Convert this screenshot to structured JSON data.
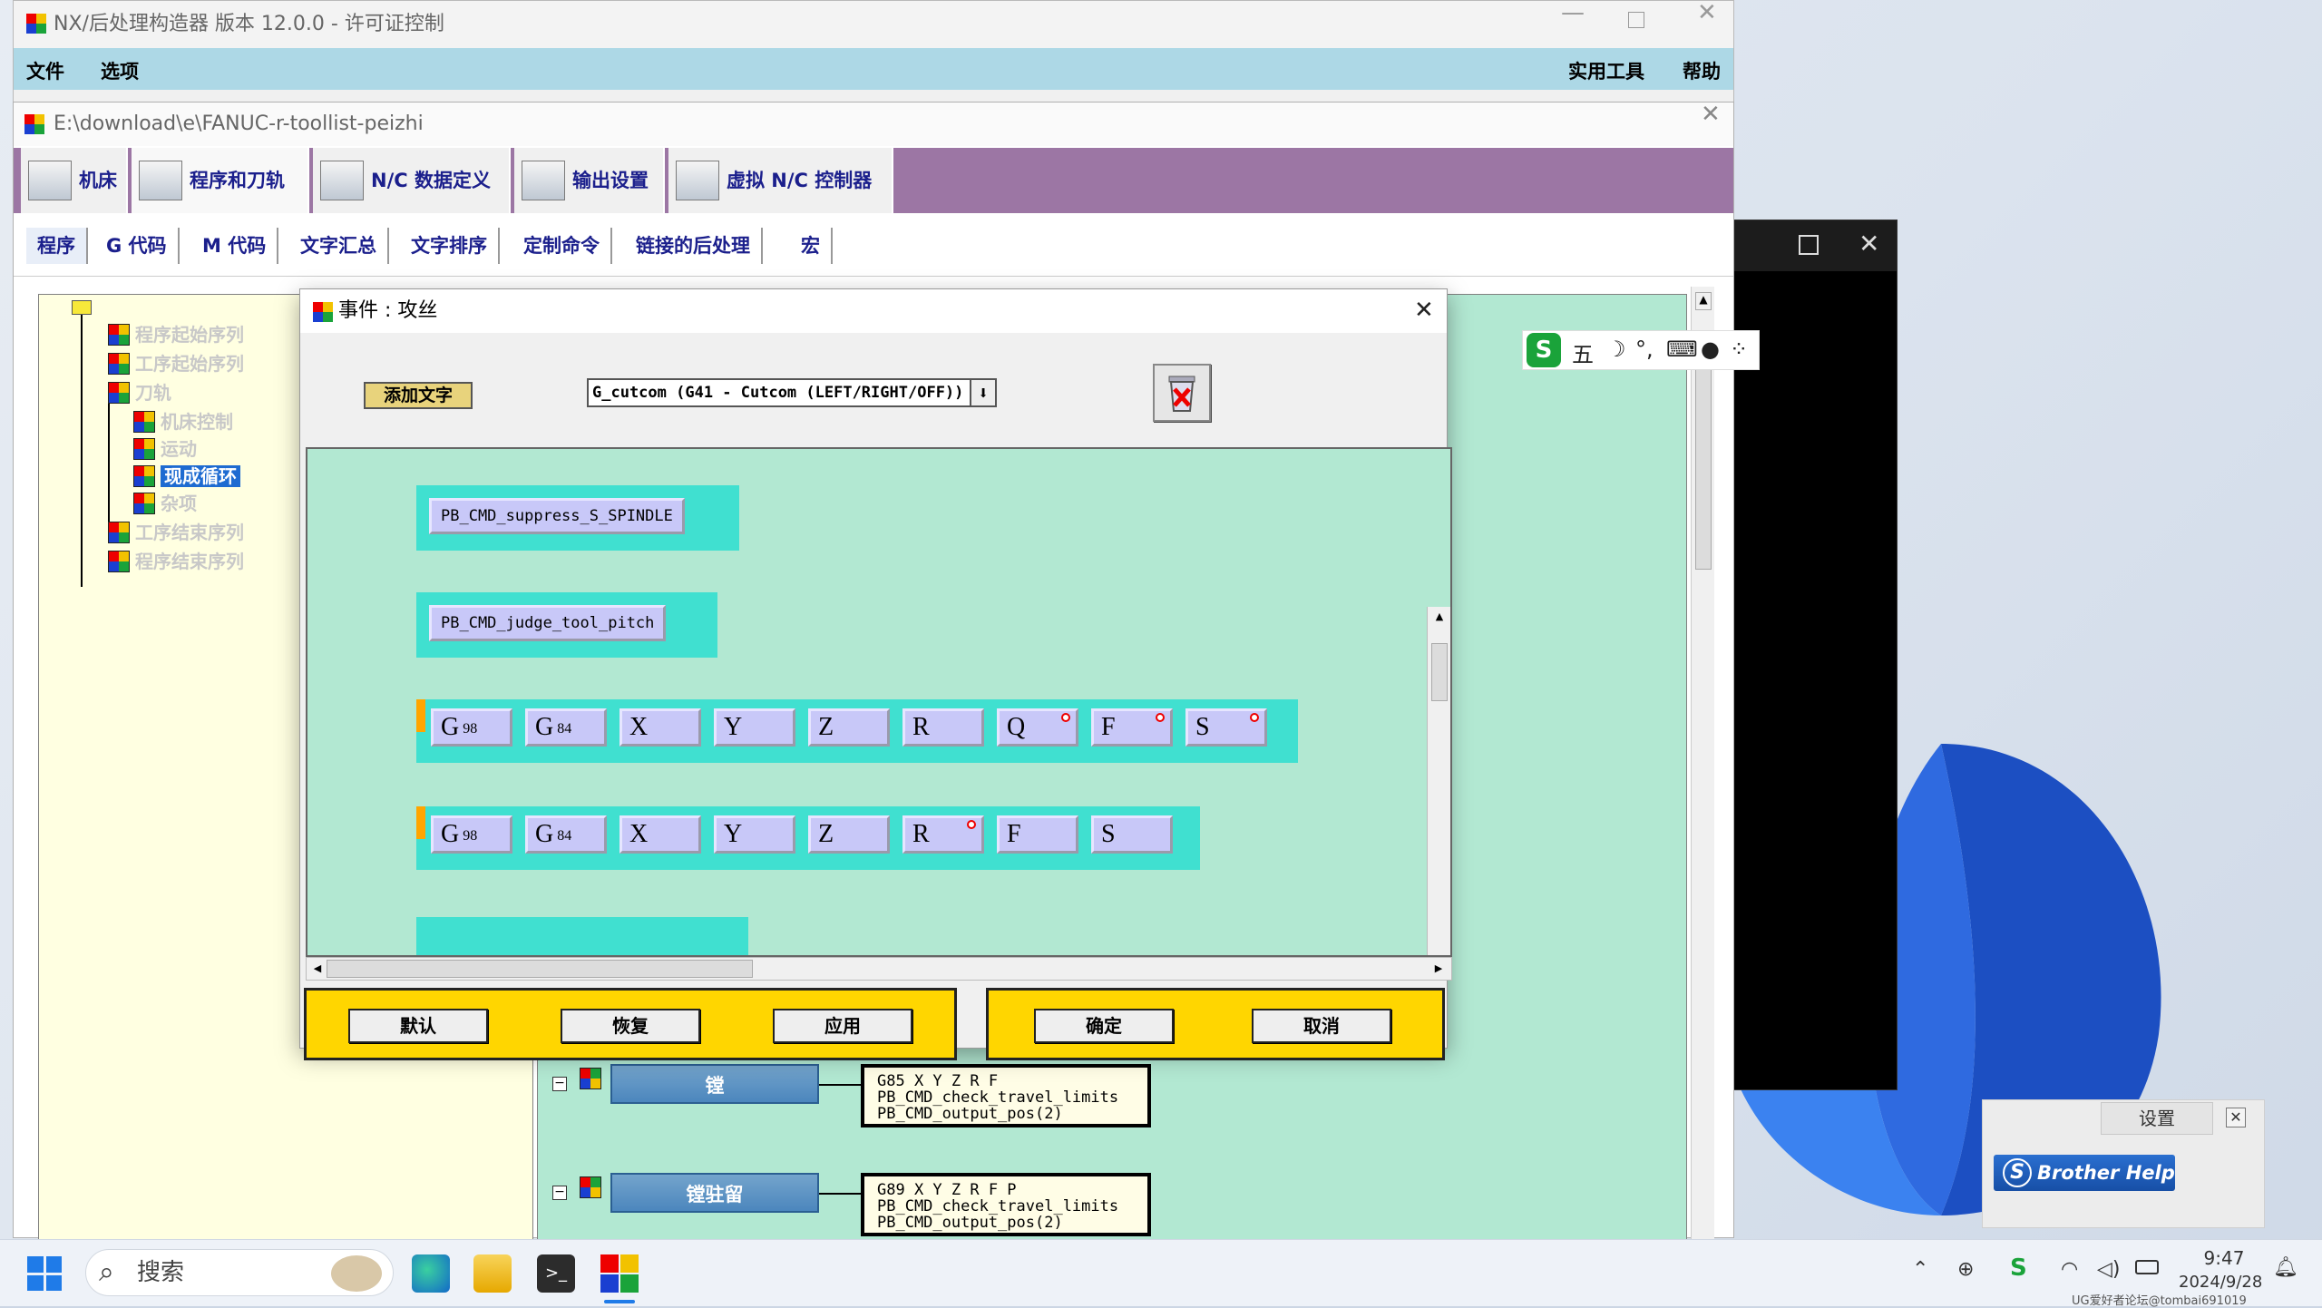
{
  "window_main": {
    "title": "NX/后处理构造器 版本 12.0.0 - 许可证控制",
    "menu": {
      "file": "文件",
      "options": "选项",
      "utilities": "实用工具",
      "help": "帮助"
    }
  },
  "window_doc": {
    "title": "E:\\download\\e\\FANUC-r-toollist-peizhi",
    "tabs": [
      {
        "label": "机床"
      },
      {
        "label": "程序和刀轨"
      },
      {
        "label": "N/C 数据定义"
      },
      {
        "label": "输出设置"
      },
      {
        "label": "虚拟 N/C 控制器"
      }
    ],
    "subtabs": [
      {
        "label": "程序"
      },
      {
        "label": "G 代码"
      },
      {
        "label": "M 代码"
      },
      {
        "label": "文字汇总"
      },
      {
        "label": "文字排序"
      },
      {
        "label": "定制命令"
      },
      {
        "label": "链接的后处理"
      },
      {
        "label": "宏"
      }
    ]
  },
  "tree": {
    "items": [
      {
        "label": "程序起始序列"
      },
      {
        "label": "工序起始序列"
      },
      {
        "label": "刀轨"
      },
      {
        "label": "机床控制"
      },
      {
        "label": "运动"
      },
      {
        "label": "现成循环"
      },
      {
        "label": "杂项"
      },
      {
        "label": "工序结束序列"
      },
      {
        "label": "程序结束序列"
      }
    ]
  },
  "events": [
    {
      "label": "镗",
      "code": "G85 X Y Z R F\nPB_CMD_check_travel_limits\nPB_CMD_output_pos(2)"
    },
    {
      "label": "镗驻留",
      "code": "G89 X Y Z R F P\nPB_CMD_check_travel_limits\nPB_CMD_output_pos(2)"
    }
  ],
  "dialog": {
    "title": "事件 : 攻丝",
    "add_text": "添加文字",
    "selector": "G_cutcom (G41 - Cutcom (LEFT/RIGHT/OFF))",
    "selector_arrow": "⬇",
    "blocks": [
      {
        "cmd": "PB_CMD_suppress_S_SPINDLE"
      },
      {
        "cmd": "PB_CMD_judge_tool_pitch"
      }
    ],
    "row1": [
      {
        "letter": "G",
        "sub": "98"
      },
      {
        "letter": "G",
        "sub": "84"
      },
      {
        "letter": "X",
        "sub": ""
      },
      {
        "letter": "Y",
        "sub": ""
      },
      {
        "letter": "Z",
        "sub": ""
      },
      {
        "letter": "R",
        "sub": ""
      },
      {
        "letter": "Q",
        "sub": ""
      },
      {
        "letter": "F",
        "sub": ""
      },
      {
        "letter": "S",
        "sub": ""
      }
    ],
    "row2": [
      {
        "letter": "G",
        "sub": "98"
      },
      {
        "letter": "G",
        "sub": "84"
      },
      {
        "letter": "X",
        "sub": ""
      },
      {
        "letter": "Y",
        "sub": ""
      },
      {
        "letter": "Z",
        "sub": ""
      },
      {
        "letter": "R",
        "sub": ""
      },
      {
        "letter": "F",
        "sub": ""
      },
      {
        "letter": "S",
        "sub": ""
      }
    ],
    "buttons": {
      "default": "默认",
      "restore": "恢复",
      "apply": "应用",
      "ok": "确定",
      "cancel": "取消"
    }
  },
  "ime": {
    "mode": "五"
  },
  "brother_help": {
    "settings": "设置",
    "brand": "Brother Help",
    "close": "✕"
  },
  "taskbar": {
    "search_placeholder": "搜索",
    "time": "9:47",
    "date": "2024/9/28",
    "watermark": "UG爱好者论坛@tombai691019"
  },
  "colors": {
    "accent_purple": "#9c76a4",
    "canvas": "#b2e8d2",
    "block": "#40e0d0",
    "footer": "#ffd600",
    "menubar": "#add8e6"
  }
}
